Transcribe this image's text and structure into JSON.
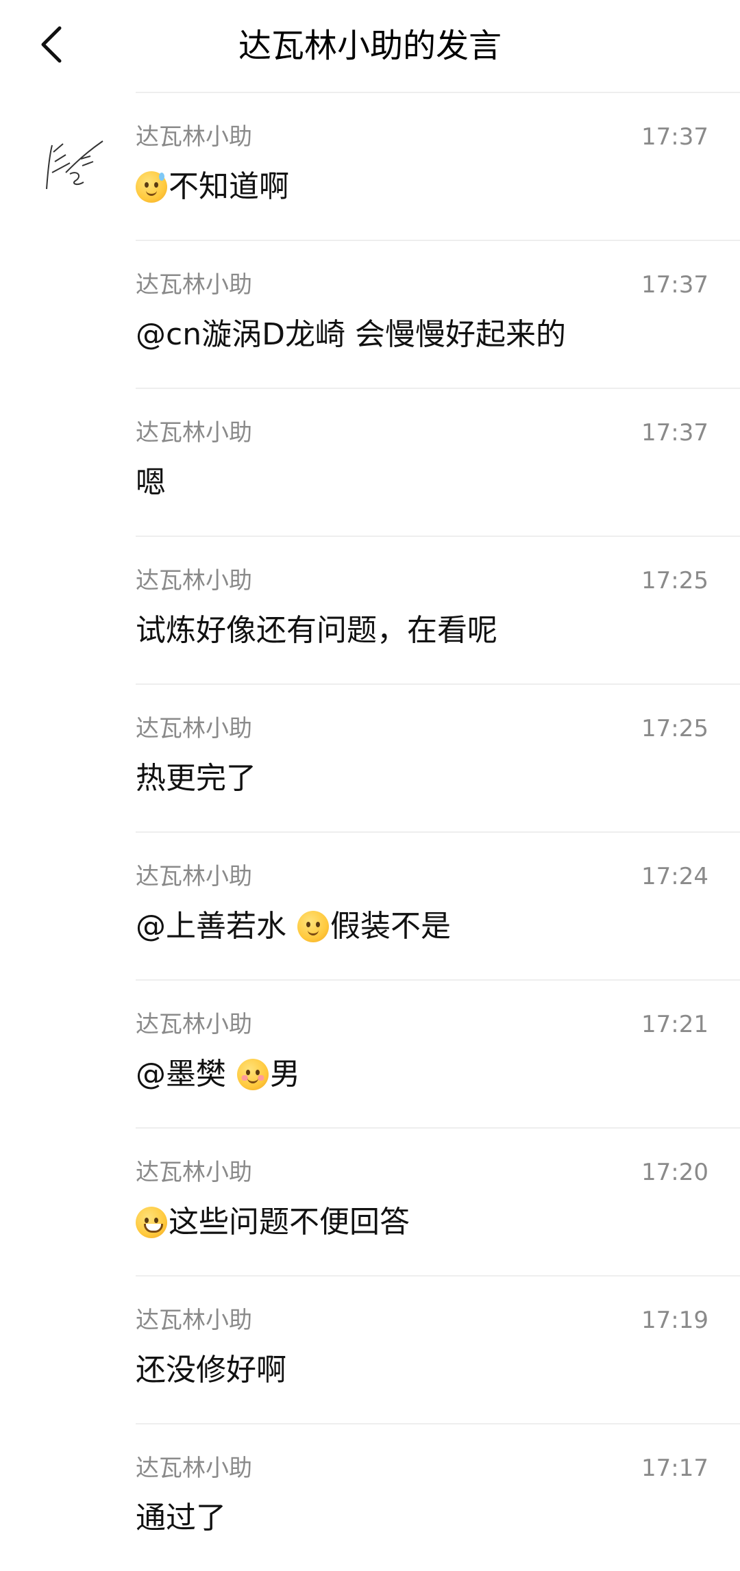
{
  "header": {
    "title": "达瓦林小助的发言"
  },
  "messages": [
    {
      "name": "达瓦林小助",
      "time": "17:37",
      "parts": [
        {
          "emoji": "sweat"
        },
        {
          "text": "不知道啊"
        }
      ]
    },
    {
      "name": "达瓦林小助",
      "time": "17:37",
      "parts": [
        {
          "text": "@cn漩涡D龙崎 会慢慢好起来的"
        }
      ]
    },
    {
      "name": "达瓦林小助",
      "time": "17:37",
      "parts": [
        {
          "text": "嗯"
        }
      ]
    },
    {
      "name": "达瓦林小助",
      "time": "17:25",
      "parts": [
        {
          "text": "试炼好像还有问题，在看呢"
        }
      ]
    },
    {
      "name": "达瓦林小助",
      "time": "17:25",
      "parts": [
        {
          "text": "热更完了"
        }
      ]
    },
    {
      "name": "达瓦林小助",
      "time": "17:24",
      "parts": [
        {
          "text": "@上善若水 "
        },
        {
          "emoji": "wink"
        },
        {
          "text": "假装不是"
        }
      ]
    },
    {
      "name": "达瓦林小助",
      "time": "17:21",
      "parts": [
        {
          "text": "@墨樊 "
        },
        {
          "emoji": "blush"
        },
        {
          "text": "男"
        }
      ]
    },
    {
      "name": "达瓦林小助",
      "time": "17:20",
      "parts": [
        {
          "emoji": "grin"
        },
        {
          "text": "这些问题不便回答"
        }
      ]
    },
    {
      "name": "达瓦林小助",
      "time": "17:19",
      "parts": [
        {
          "text": "还没修好啊"
        }
      ]
    },
    {
      "name": "达瓦林小助",
      "time": "17:17",
      "parts": [
        {
          "text": "通过了"
        }
      ]
    }
  ]
}
